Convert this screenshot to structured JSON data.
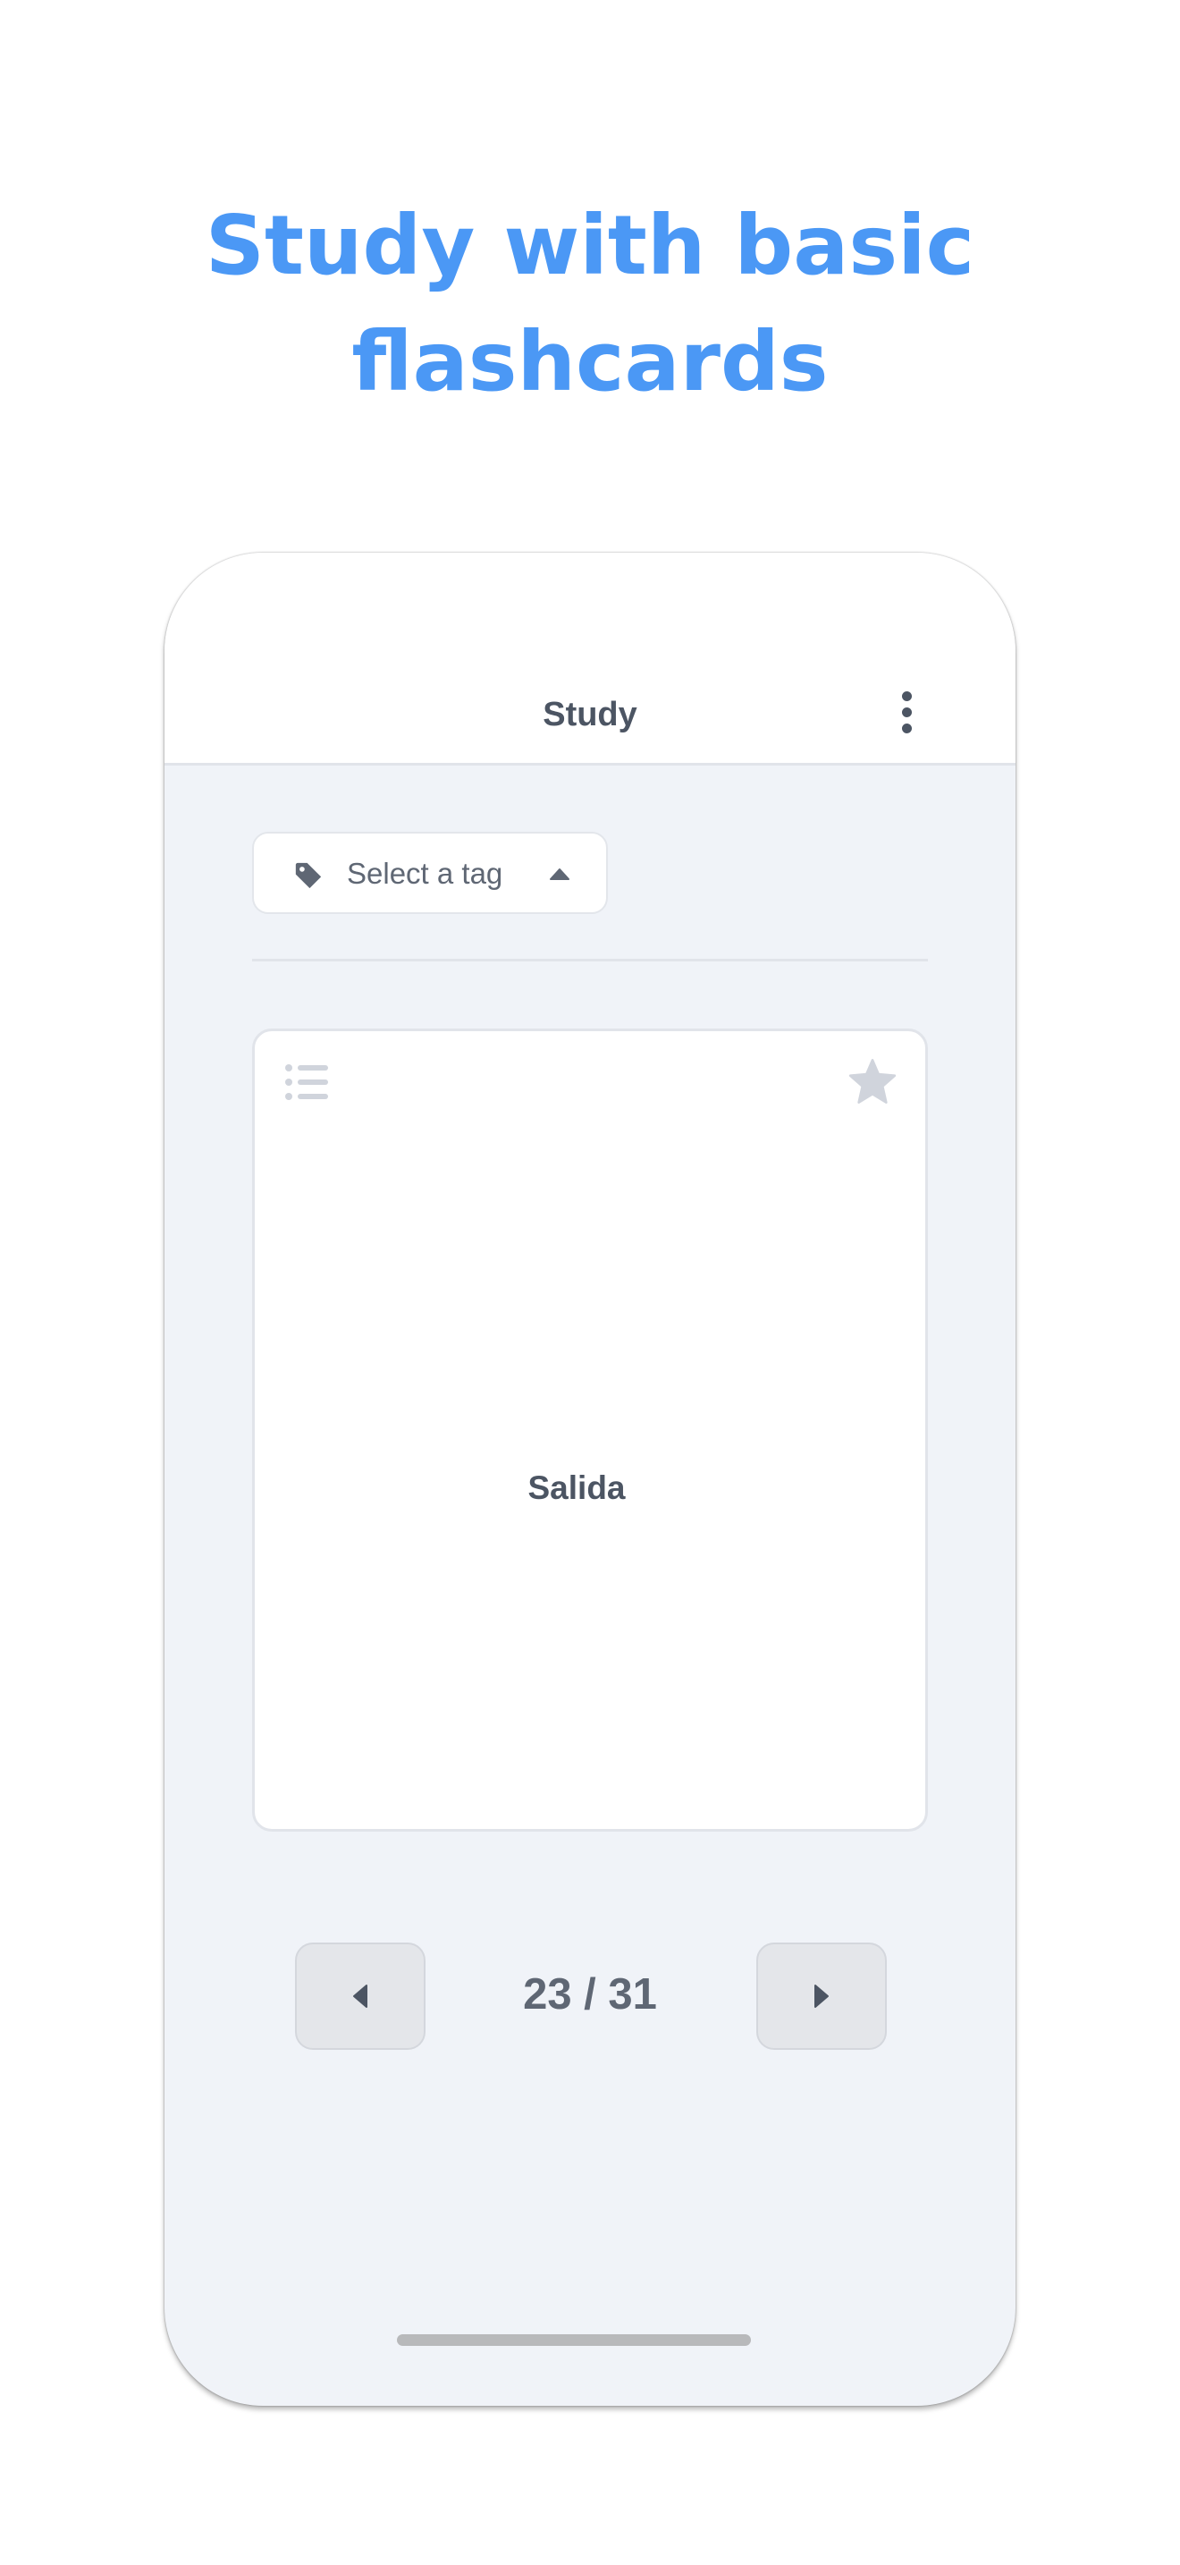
{
  "headline": {
    "line1": "Study with basic",
    "line2": "flashcards"
  },
  "colors": {
    "accent": "#4b98f5",
    "text_primary": "#4c5563",
    "background": "#f0f3f8",
    "icon_muted": "#d0d4dc"
  },
  "phone": {
    "header": {
      "title": "Study",
      "menu_icon": "more-vertical-icon"
    },
    "tag_select": {
      "label": "Select a tag",
      "icon": "tag-icon",
      "caret_icon": "caret-up-icon"
    },
    "card": {
      "word": "Salida",
      "list_icon": "list-icon",
      "favorite_icon": "star-icon"
    },
    "navigation": {
      "counter": "23 / 31",
      "prev_icon": "caret-left-icon",
      "next_icon": "caret-right-icon"
    }
  }
}
